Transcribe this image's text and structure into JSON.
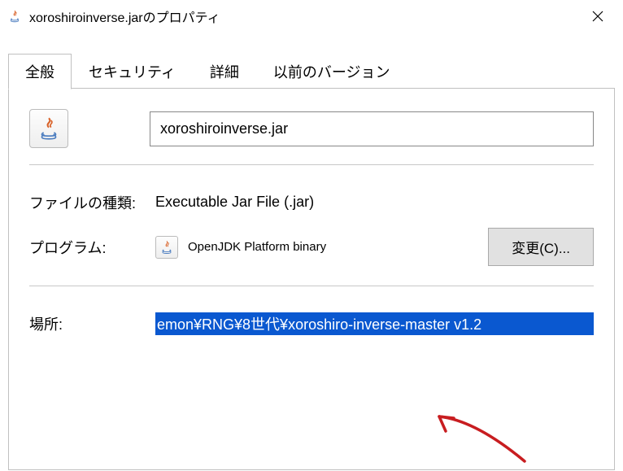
{
  "window": {
    "title": "xoroshiroinverse.jarのプロパティ"
  },
  "tabs": {
    "general": "全般",
    "security": "セキュリティ",
    "details": "詳細",
    "previous": "以前のバージョン"
  },
  "panel": {
    "filename": "xoroshiroinverse.jar",
    "filetype_label": "ファイルの種類:",
    "filetype_value": "Executable Jar File (.jar)",
    "program_label": "プログラム:",
    "program_value": "OpenJDK Platform binary",
    "change_button": "変更(C)...",
    "location_label": "場所:",
    "location_value": "emon¥RNG¥8世代¥xoroshiro-inverse-master v1.2"
  }
}
